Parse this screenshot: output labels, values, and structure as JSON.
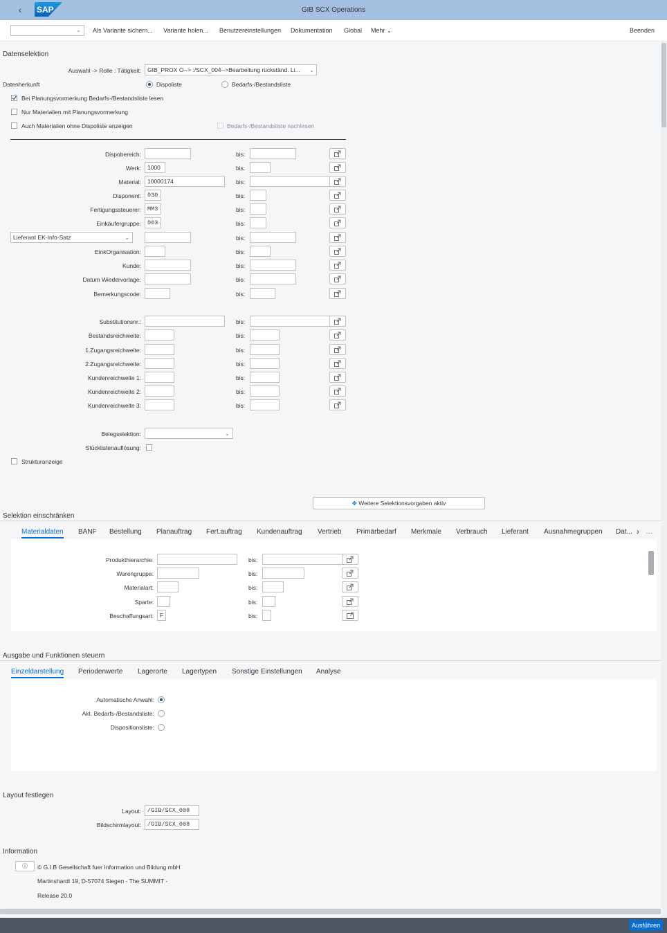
{
  "shell": {
    "title": "GIB SCX Operations",
    "logo": "SAP"
  },
  "toolbar": {
    "variant_select": "",
    "items": [
      "Als Variante sichern...",
      "Variante holen...",
      "Benutzereinstellungen",
      "Dokumentation",
      "Global",
      "Mehr"
    ],
    "end": "Beenden"
  },
  "datensel": {
    "title": "Datenselektion",
    "role_label": "Auswahl -> Rolle : Tätigkeit:",
    "role_value": "GIB_PROX O--> :/SCX_004-->Bearbeitung rückständ. Li...",
    "herkunft_label": "Datenherkunft",
    "radio1": "Dispoliste",
    "radio2": "Bedarfs-/Bestandsliste",
    "cb1": "Bei Planungsvormerkung Bedarfs-/Bestandsliste lesen",
    "cb2": "Nur Materialien mit Planungsvormerkung",
    "cb3": "Auch Materialien ohne Dispoliste anzeigen",
    "cb4": "Bedarfs-/Bestandsliste nachlesen",
    "bis": "bis:",
    "fields": [
      {
        "label": "Dispobereich:",
        "value": ""
      },
      {
        "label": "Werk:",
        "value": "1000"
      },
      {
        "label": "Material:",
        "value": "10000174"
      },
      {
        "label": "Disponent:",
        "value": "030"
      },
      {
        "label": "Fertigungssteuerer:",
        "value": "MM3"
      },
      {
        "label": "Einkäufergruppe:",
        "value": "003"
      },
      {
        "label": "Lieferant EK-Info-Satz",
        "value": ""
      },
      {
        "label": "EinkOrganisation:",
        "value": ""
      },
      {
        "label": "Kunde:",
        "value": ""
      },
      {
        "label": "Datum Wiedervorlage:",
        "value": ""
      },
      {
        "label": "Bemerkungscode:",
        "value": ""
      },
      {
        "label": "Substitutionsnr.:",
        "value": ""
      },
      {
        "label": "Bestandsreichweite:",
        "value": ""
      },
      {
        "label": "1.Zugangsreichweite:",
        "value": ""
      },
      {
        "label": "2.Zugangsreichweite:",
        "value": ""
      },
      {
        "label": "Kundenreichweite 1:",
        "value": ""
      },
      {
        "label": "Kundenreichweite 2:",
        "value": ""
      },
      {
        "label": "Kundenreichweite 3:",
        "value": ""
      }
    ],
    "belegsel_label": "Belegselektion:",
    "stueck_label": "Stücklistenauflösung:",
    "struktur_label": "Strukturanzeige",
    "weitere_button": "Weitere Selektionsvorgaben aktiv"
  },
  "einschr": {
    "title": "Selektion einschränken",
    "tabs": [
      "Materialdaten",
      "BANF",
      "Bestellung",
      "Planauftrag",
      "Fert.auftrag",
      "Kundenauftrag",
      "Vertrieb",
      "Primärbedarf",
      "Merkmale",
      "Verbrauch",
      "Lieferant",
      "Ausnahmegruppen",
      "Dat..."
    ],
    "fields": [
      {
        "label": "Produkthierarchie:",
        "value": ""
      },
      {
        "label": "Warengruppe:",
        "value": ""
      },
      {
        "label": "Materialart:",
        "value": ""
      },
      {
        "label": "Sparte:",
        "value": ""
      },
      {
        "label": "Beschaffungsart:",
        "value": "F"
      }
    ]
  },
  "ausgabe": {
    "title": "Ausgabe und Funktionen steuern",
    "tabs": [
      "Einzeldarstellung",
      "Periodenwerte",
      "Lagerorte",
      "Lagertypen",
      "Sonstige Einstellungen",
      "Analyse"
    ],
    "opts": [
      "Automatische Anwahl:",
      "Akt. Bedarfs-/Bestandsliste:",
      "Dispositionsliste:"
    ]
  },
  "layout": {
    "title": "Layout festlegen",
    "layout_label": "Layout:",
    "layout_value": "/GIB/SCX_008",
    "bild_label": "Bildschirmlayout:",
    "bild_value": "/GIB/SCX_008"
  },
  "info": {
    "title": "Information",
    "line1": "© G.I.B Gesellschaft fuer Information und Bildung mbH",
    "line2": "Martinshardt 19, D-57074 Siegen - The SUMMIT -",
    "line3": "Release 20.0"
  },
  "footer": {
    "execute": "Ausführen"
  }
}
